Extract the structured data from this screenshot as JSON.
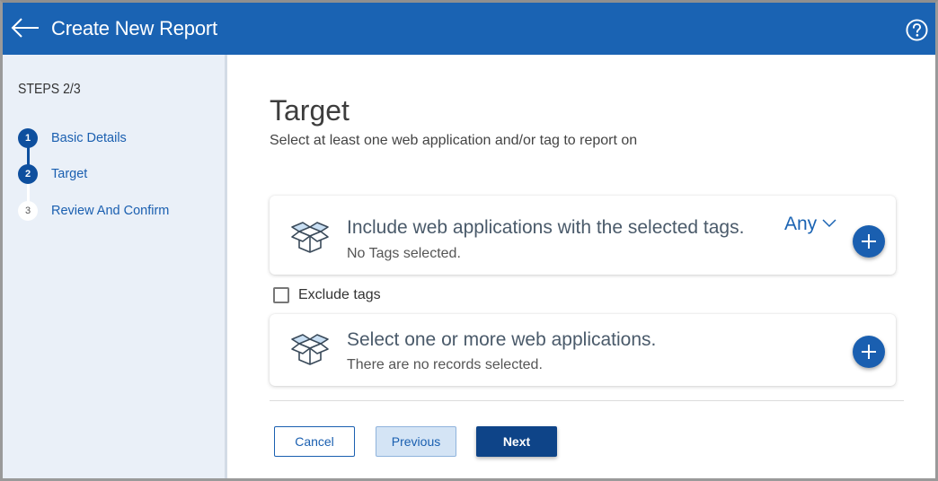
{
  "header": {
    "title": "Create New Report",
    "back_icon": "arrow-left-icon",
    "help_icon": "help-circle-icon",
    "background": "#1a63b3"
  },
  "sidebar": {
    "steps_title": "STEPS 2/3",
    "steps": [
      {
        "number": "1",
        "label": "Basic Details",
        "state": "completed"
      },
      {
        "number": "2",
        "label": "Target",
        "state": "current"
      },
      {
        "number": "3",
        "label": "Review And Confirm",
        "state": "pending"
      }
    ]
  },
  "main": {
    "title": "Target",
    "subtitle": "Select at least one web application and/or tag to report on",
    "tags_card": {
      "icon": "open-box-icon",
      "title": "Include web applications with the selected tags.",
      "match_mode": "Any",
      "status": "No Tags selected."
    },
    "exclude": {
      "label": "Exclude tags",
      "checked": false
    },
    "apps_card": {
      "icon": "open-box-icon",
      "title": "Select one or more web applications.",
      "status": "There are no records selected."
    }
  },
  "footer": {
    "cancel_label": "Cancel",
    "previous_label": "Previous",
    "next_label": "Next"
  },
  "colors": {
    "accent": "#1a5fb0",
    "primary_dark": "#0e4488",
    "sidebar_bg": "#eaf0f8"
  }
}
